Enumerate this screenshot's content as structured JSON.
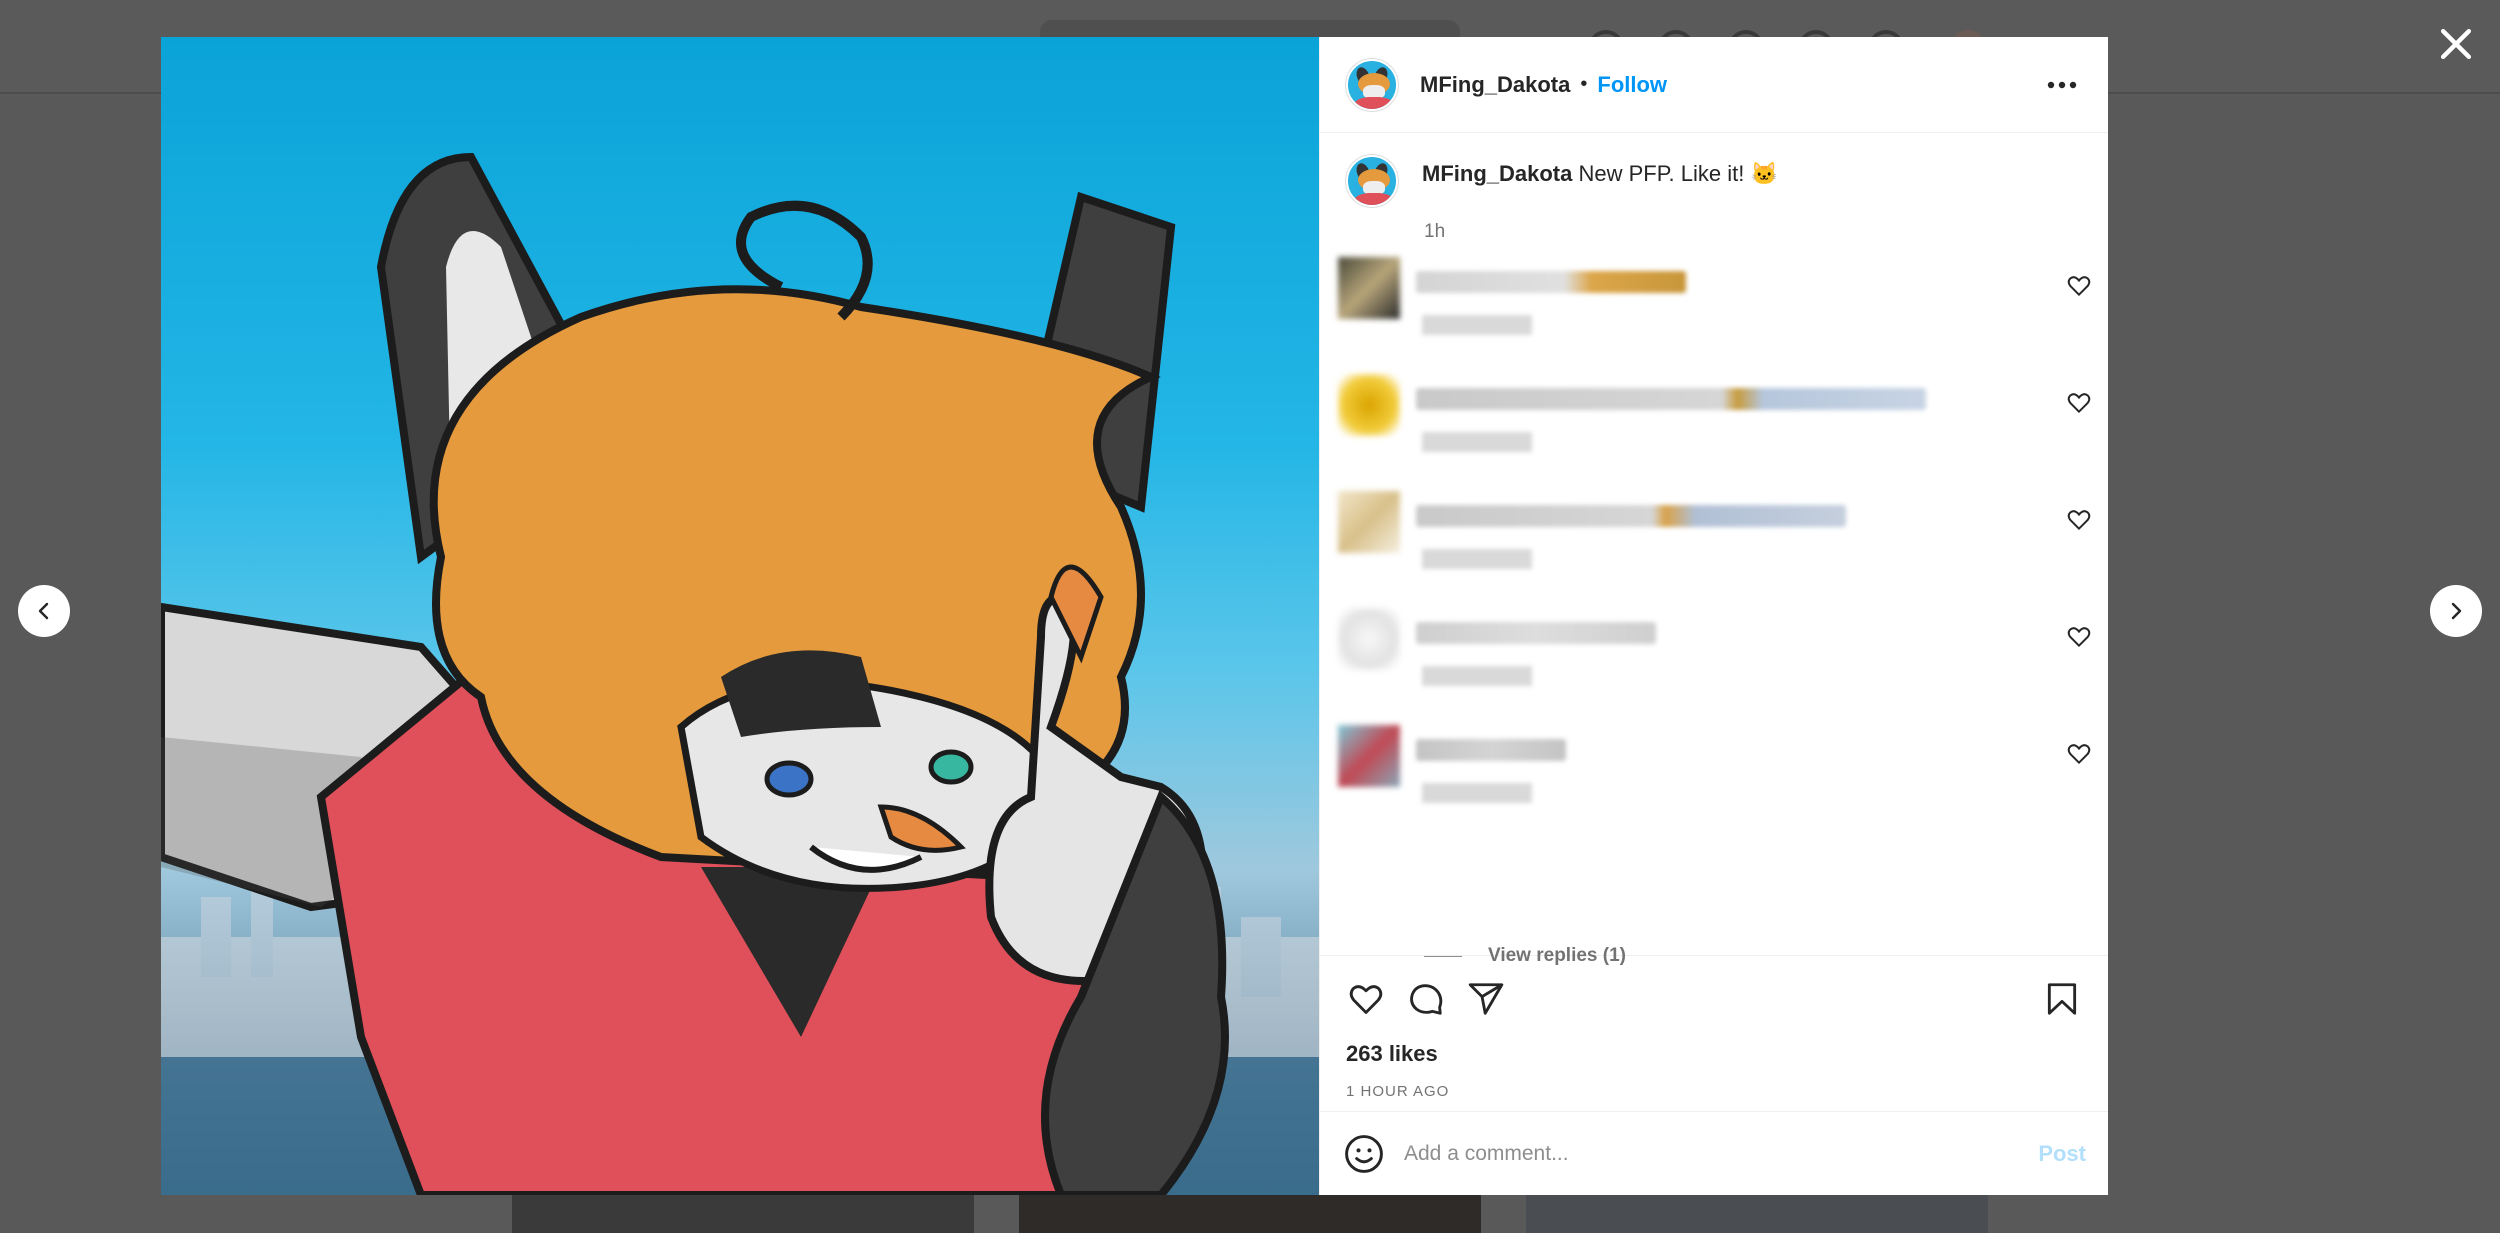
{
  "post": {
    "username": "MFing_Dakota",
    "follow_label": "Follow",
    "caption_user": "MFing_Dakota",
    "caption_text": "New PFP. Like it! 🐱",
    "caption_time": "1h",
    "likes": "263 likes",
    "date": "1 HOUR AGO"
  },
  "comments": {
    "view_replies": "View replies (1)"
  },
  "composer": {
    "placeholder": "Add a comment...",
    "post_label": "Post"
  },
  "icons": [
    "close-icon",
    "chevron-left-icon",
    "chevron-right-icon",
    "more-icon",
    "heart-icon",
    "comment-icon",
    "share-icon",
    "bookmark-icon",
    "emoji-icon"
  ]
}
